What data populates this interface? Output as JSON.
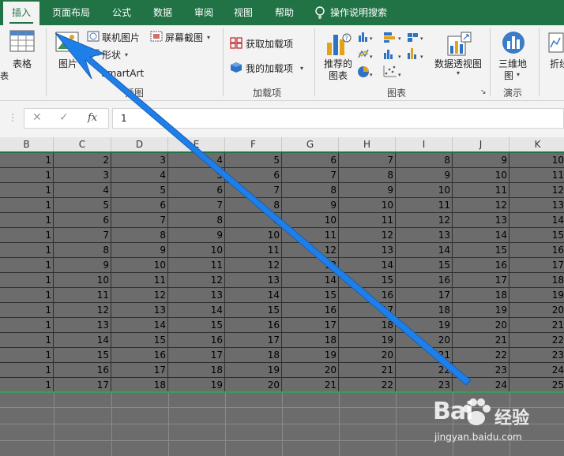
{
  "tabs": [
    {
      "label": "插入",
      "active": true
    },
    {
      "label": "页面布局",
      "active": false
    },
    {
      "label": "公式",
      "active": false
    },
    {
      "label": "数据",
      "active": false
    },
    {
      "label": "审阅",
      "active": false
    },
    {
      "label": "视图",
      "active": false
    },
    {
      "label": "帮助",
      "active": false
    }
  ],
  "tell_me": "操作说明搜索",
  "ribbon": {
    "table_label": "表格",
    "picture_label": "图片",
    "online_pictures": "联机图片",
    "shapes": "形状",
    "screenshot": "屏幕截图",
    "smartart": "SmartArt",
    "illustrations_group": "插图",
    "get_addins": "获取加载项",
    "my_addins": "我的加载项",
    "addins_group": "加载项",
    "recommended_charts_1": "推荐的",
    "recommended_charts_2": "图表",
    "pivot_chart": "数据透视图",
    "charts_group": "图表",
    "map_3d_1": "三维地",
    "map_3d_2": "图",
    "tours_group": "演示",
    "line_partial": "折线"
  },
  "formula_bar": {
    "fx": "fx",
    "value": "1"
  },
  "columns": [
    "B",
    "C",
    "D",
    "E",
    "F",
    "G",
    "H",
    "I",
    "J",
    "K"
  ],
  "rows": [
    [
      1,
      2,
      3,
      4,
      5,
      6,
      7,
      8,
      9,
      10
    ],
    [
      1,
      3,
      4,
      5,
      6,
      7,
      8,
      9,
      10,
      11
    ],
    [
      1,
      4,
      5,
      6,
      7,
      8,
      9,
      10,
      11,
      12
    ],
    [
      1,
      5,
      6,
      7,
      8,
      9,
      10,
      11,
      12,
      13
    ],
    [
      1,
      6,
      7,
      8,
      9,
      10,
      11,
      12,
      13,
      14
    ],
    [
      1,
      7,
      8,
      9,
      10,
      11,
      12,
      13,
      14,
      15
    ],
    [
      1,
      8,
      9,
      10,
      11,
      12,
      13,
      14,
      15,
      16
    ],
    [
      1,
      9,
      10,
      11,
      12,
      13,
      14,
      15,
      16,
      17
    ],
    [
      1,
      10,
      11,
      12,
      13,
      14,
      15,
      16,
      17,
      18
    ],
    [
      1,
      11,
      12,
      13,
      14,
      15,
      16,
      17,
      18,
      19
    ],
    [
      1,
      12,
      13,
      14,
      15,
      16,
      17,
      18,
      19,
      20
    ],
    [
      1,
      13,
      14,
      15,
      16,
      17,
      18,
      19,
      20,
      21
    ],
    [
      1,
      14,
      15,
      16,
      17,
      18,
      19,
      20,
      21,
      22
    ],
    [
      1,
      15,
      16,
      17,
      18,
      19,
      20,
      21,
      22,
      23
    ],
    [
      1,
      16,
      17,
      18,
      19,
      20,
      21,
      22,
      23,
      24
    ],
    [
      1,
      17,
      18,
      19,
      20,
      21,
      22,
      23,
      24,
      25
    ]
  ],
  "watermark": {
    "brand": "Bai",
    "brand_cn": "经验",
    "url": "jingyan.baidu.com"
  },
  "colors": {
    "excel_green": "#217346",
    "selection_fill": "#6c6c6c",
    "arrow_blue": "#1f7fe8"
  }
}
